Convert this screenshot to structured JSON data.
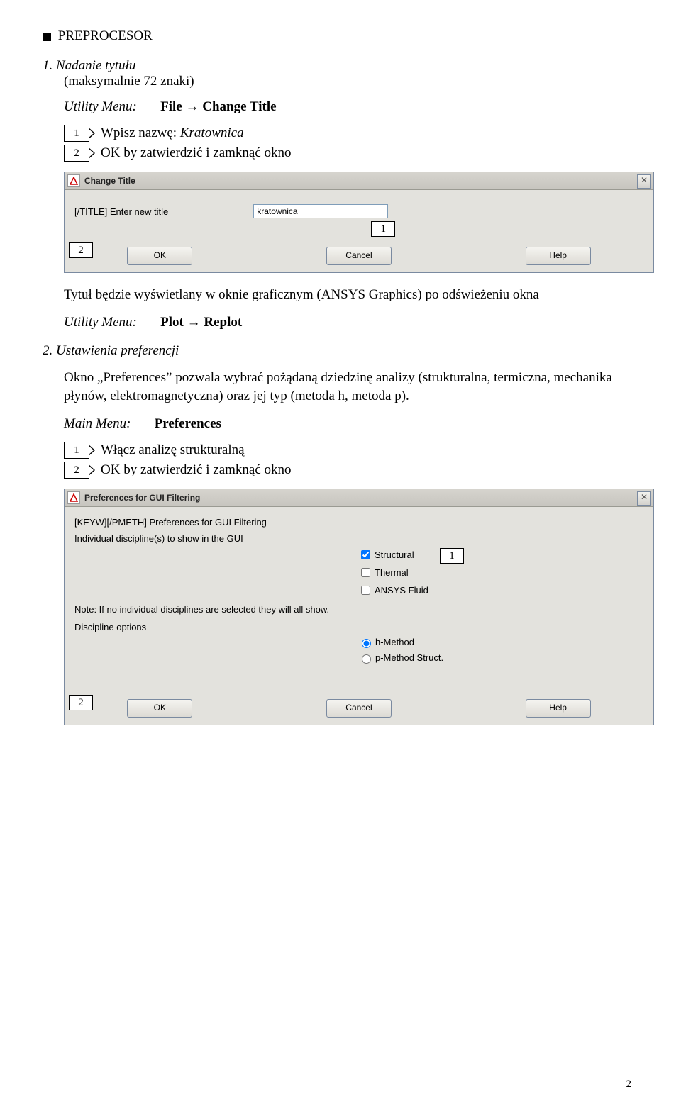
{
  "header": {
    "preprocessor": "PREPROCESOR"
  },
  "sec1": {
    "num": "1.",
    "title": "Nadanie tytułu",
    "sub": "(maksymalnie 72 znaki)",
    "menu_label": "Utility Menu:",
    "menu_path": "File → Change Title",
    "steps": [
      {
        "n": "1",
        "text_prefix": "Wpisz nazwę: ",
        "text_italic": "Kratownica"
      },
      {
        "n": "2",
        "text": "OK by zatwierdzić i zamknąć okno"
      }
    ]
  },
  "dlg1": {
    "title": "Change Title",
    "prompt": "[/TITLE]  Enter new title",
    "input_value": "kratownica",
    "ok": "OK",
    "cancel": "Cancel",
    "help": "Help",
    "overlay_1": "1",
    "overlay_2": "2"
  },
  "between1": {
    "text": "Tytuł będzie wyświetlany w oknie graficznym (ANSYS Graphics) po odświeżeniu okna",
    "menu_label": "Utility Menu:",
    "menu_path": "Plot → Replot"
  },
  "sec2": {
    "num": "2.",
    "title": "Ustawienia preferencji",
    "desc": "Okno „Preferences” pozwala wybrać pożądaną dziedzinę analizy (strukturalna, termiczna, mechanika płynów, elektromagnetyczna) oraz jej typ (metoda h, metoda p).",
    "menu_label": "Main Menu:",
    "menu_path": "Preferences",
    "steps": [
      {
        "n": "1",
        "text": "Włącz analizę strukturalną"
      },
      {
        "n": "2",
        "text": "OK by zatwierdzić i zamknąć okno"
      }
    ]
  },
  "dlg2": {
    "title": "Preferences for GUI Filtering",
    "line1": "[KEYW][/PMETH] Preferences for GUI Filtering",
    "line2": "Individual discipline(s) to show in the GUI",
    "opt_structural": "Structural",
    "opt_thermal": "Thermal",
    "opt_fluid": "ANSYS Fluid",
    "note": "Note: If no individual disciplines are selected they will all show.",
    "disc_opt_label": "Discipline options",
    "radio_h": "h-Method",
    "radio_p": "p-Method Struct.",
    "ok": "OK",
    "cancel": "Cancel",
    "help": "Help",
    "overlay_1": "1",
    "overlay_2": "2"
  },
  "page_number": "2"
}
